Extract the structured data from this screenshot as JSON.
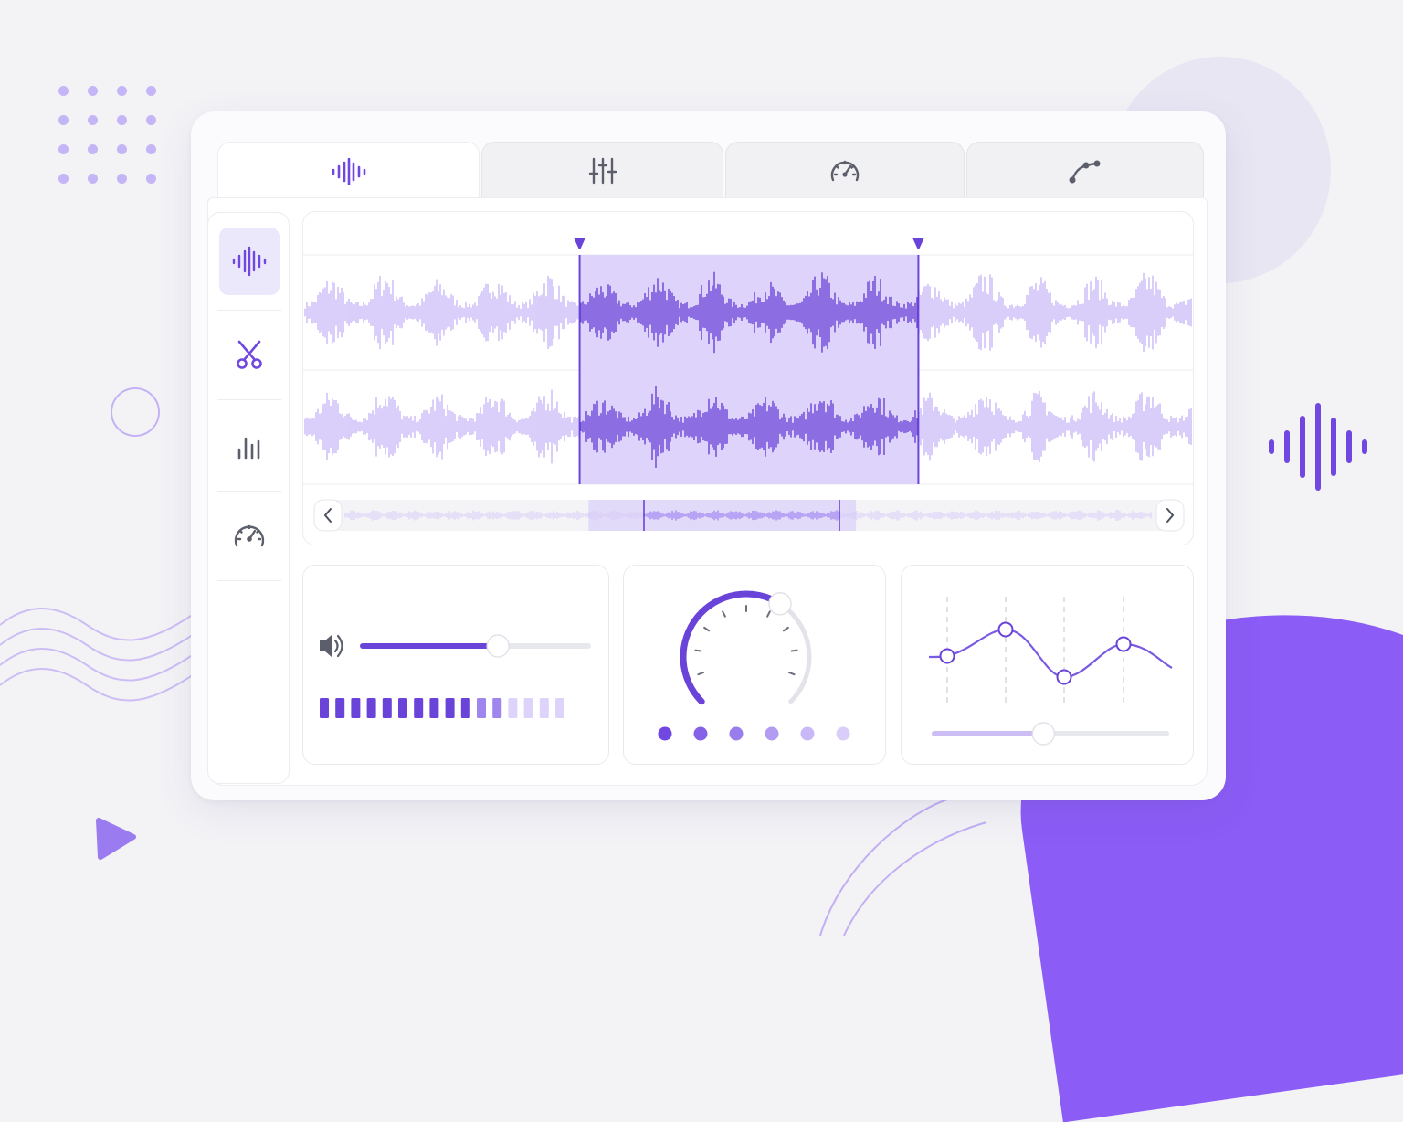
{
  "tabs": [
    {
      "icon": "waveform-icon",
      "active": true
    },
    {
      "icon": "mixer-sliders-icon",
      "active": false
    },
    {
      "icon": "gauge-icon",
      "active": false
    },
    {
      "icon": "curve-path-icon",
      "active": false
    }
  ],
  "sidebar": {
    "items": [
      {
        "icon": "waveform-icon",
        "active": true
      },
      {
        "icon": "scissors-icon",
        "active": false
      },
      {
        "icon": "bar-chart-icon",
        "active": false
      },
      {
        "icon": "gauge-icon",
        "active": false
      }
    ]
  },
  "editor": {
    "selection_start_fraction": 0.31,
    "selection_end_fraction": 0.69,
    "scroll_view_start_fraction": 0.32,
    "scroll_view_end_fraction": 0.62
  },
  "volume": {
    "level_fraction": 0.6,
    "meter_segments_total": 16,
    "meter_segments_active": 12
  },
  "knob": {
    "value_fraction": 0.62,
    "preset_dots": 6
  },
  "curve": {
    "slider_fraction": 0.47,
    "node_count": 4
  },
  "colors": {
    "accent": "#7047e0",
    "accent_light": "#c9b8f7",
    "selection_bg": "#ddd3fb",
    "blob": "#8b5cf6"
  }
}
